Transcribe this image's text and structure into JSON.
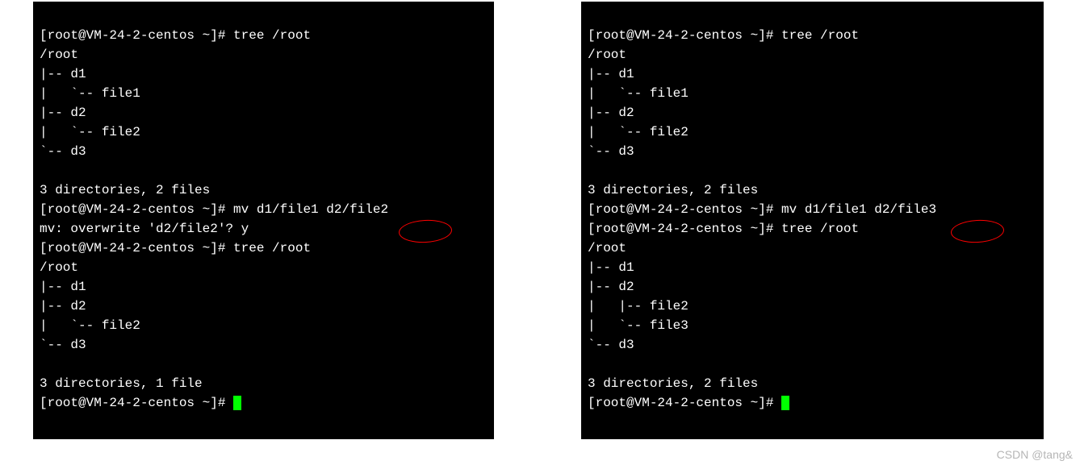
{
  "left": {
    "l0": "[root@VM-24-2-centos ~]# tree /root",
    "l1": "/root",
    "l2": "|-- d1",
    "l3": "|   `-- file1",
    "l4": "|-- d2",
    "l5": "|   `-- file2",
    "l6": "`-- d3",
    "l7": "",
    "l8": "3 directories, 2 files",
    "l9": "[root@VM-24-2-centos ~]# mv d1/file1 d2/file2",
    "l10": "mv: overwrite 'd2/file2'? y",
    "l11": "[root@VM-24-2-centos ~]# tree /root",
    "l12": "/root",
    "l13": "|-- d1",
    "l14": "|-- d2",
    "l15": "|   `-- file2",
    "l16": "`-- d3",
    "l17": "",
    "l18": "3 directories, 1 file",
    "l19": "[root@VM-24-2-centos ~]# "
  },
  "right": {
    "l0": "[root@VM-24-2-centos ~]# tree /root",
    "l1": "/root",
    "l2": "|-- d1",
    "l3": "|   `-- file1",
    "l4": "|-- d2",
    "l5": "|   `-- file2",
    "l6": "`-- d3",
    "l7": "",
    "l8": "3 directories, 2 files",
    "l9": "[root@VM-24-2-centos ~]# mv d1/file1 d2/file3",
    "l10": "[root@VM-24-2-centos ~]# tree /root",
    "l11": "/root",
    "l12": "|-- d1",
    "l13": "|-- d2",
    "l14": "|   |-- file2",
    "l15": "|   `-- file3",
    "l16": "`-- d3",
    "l17": "",
    "l18": "3 directories, 2 files",
    "l19": "[root@VM-24-2-centos ~]# "
  },
  "watermark": "CSDN @tang&",
  "circled": {
    "left": "file2",
    "right": "file3"
  }
}
